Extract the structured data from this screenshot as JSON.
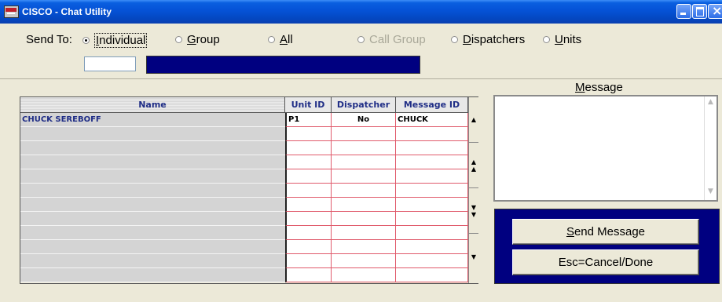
{
  "window": {
    "title": "CISCO - Chat Utility"
  },
  "send_to": {
    "label": "Send To:",
    "options": [
      {
        "key": "I",
        "rest": "ndividual",
        "selected": true,
        "enabled": true
      },
      {
        "key": "G",
        "rest": "roup",
        "selected": false,
        "enabled": true
      },
      {
        "key": "A",
        "rest": "ll",
        "selected": false,
        "enabled": true
      },
      {
        "key": "",
        "rest": "Call Group",
        "selected": false,
        "enabled": false
      },
      {
        "key": "D",
        "rest": "ispatchers",
        "selected": false,
        "enabled": true
      },
      {
        "key": "U",
        "rest": "nits",
        "selected": false,
        "enabled": true
      }
    ],
    "id_value": "",
    "name_value": ""
  },
  "grid": {
    "columns": [
      "Name",
      "Unit ID",
      "Dispatcher",
      "Message ID"
    ],
    "rows": [
      {
        "name": "CHUCK SEREBOFF",
        "unit_id": "P1",
        "dispatcher": "No",
        "message_id": "CHUCK"
      },
      {
        "name": "",
        "unit_id": "",
        "dispatcher": "",
        "message_id": ""
      },
      {
        "name": "",
        "unit_id": "",
        "dispatcher": "",
        "message_id": ""
      },
      {
        "name": "",
        "unit_id": "",
        "dispatcher": "",
        "message_id": ""
      },
      {
        "name": "",
        "unit_id": "",
        "dispatcher": "",
        "message_id": ""
      },
      {
        "name": "",
        "unit_id": "",
        "dispatcher": "",
        "message_id": ""
      },
      {
        "name": "",
        "unit_id": "",
        "dispatcher": "",
        "message_id": ""
      },
      {
        "name": "",
        "unit_id": "",
        "dispatcher": "",
        "message_id": ""
      },
      {
        "name": "",
        "unit_id": "",
        "dispatcher": "",
        "message_id": ""
      },
      {
        "name": "",
        "unit_id": "",
        "dispatcher": "",
        "message_id": ""
      },
      {
        "name": "",
        "unit_id": "",
        "dispatcher": "",
        "message_id": ""
      },
      {
        "name": "",
        "unit_id": "",
        "dispatcher": "",
        "message_id": ""
      }
    ]
  },
  "message": {
    "title_key": "M",
    "title_rest": "essage",
    "text": ""
  },
  "buttons": {
    "send_key": "S",
    "send_rest": "end Message",
    "cancel_label": "Esc=Cancel/Done"
  }
}
